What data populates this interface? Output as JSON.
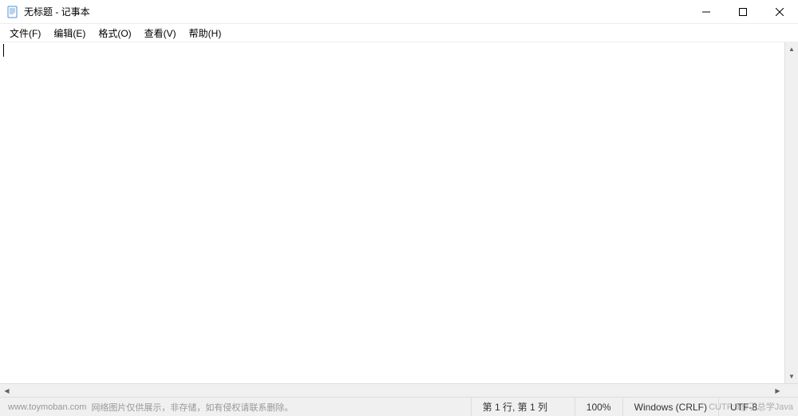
{
  "window": {
    "title": "无标题 - 记事本"
  },
  "menu": {
    "file": "文件(F)",
    "edit": "编辑(E)",
    "format": "格式(O)",
    "view": "查看(V)",
    "help": "帮助(H)"
  },
  "editor": {
    "content": ""
  },
  "status": {
    "position": "第 1 行, 第 1 列",
    "zoom": "100%",
    "line_ending": "Windows (CRLF)",
    "encoding": "UTF-8"
  },
  "footer": {
    "site": "www.toymoban.com",
    "note": "网络图片仅供展示，非存储，如有侵权请联系删除。"
  },
  "overlay": {
    "watermark": "CUTF:8@丁总学Java"
  }
}
